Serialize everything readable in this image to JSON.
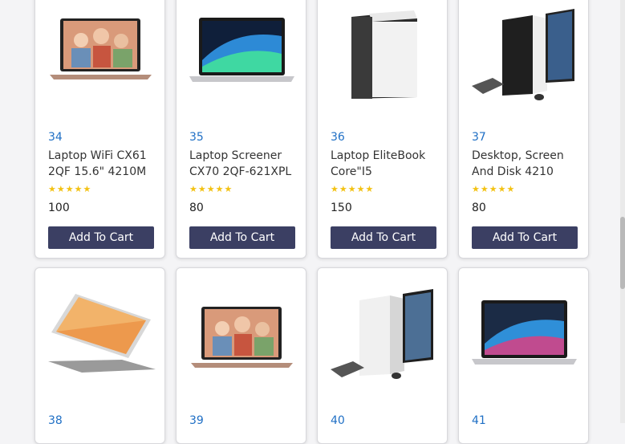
{
  "products": [
    {
      "id": "34",
      "name": "Laptop WiFi CX61\n2QF 15.6\" 4210M",
      "stars": "★★★★★",
      "price": "100",
      "cart_label": "Add To Cart",
      "image": "laptop-video-call"
    },
    {
      "id": "35",
      "name": "Laptop Screener\nCX70 2QF-621XPL",
      "stars": "★★★★★",
      "price": "80",
      "cart_label": "Add To Cart",
      "image": "macbook"
    },
    {
      "id": "36",
      "name": "Laptop EliteBook\nCore\"I5",
      "stars": "★★★★★",
      "price": "150",
      "cart_label": "Add To Cart",
      "image": "pc-tower"
    },
    {
      "id": "37",
      "name": "Desktop, Screen\nAnd Disk 4210",
      "stars": "★★★★★",
      "price": "80",
      "cart_label": "Add To Cart",
      "image": "desktop-set"
    },
    {
      "id": "38",
      "image": "convertible-laptop"
    },
    {
      "id": "39",
      "image": "laptop-video-call"
    },
    {
      "id": "40",
      "image": "desktop-set"
    },
    {
      "id": "41",
      "image": "macbook"
    }
  ],
  "colors": {
    "accent": "#3b3f63",
    "id_blue": "#1f6fc5",
    "star": "#f3c213"
  }
}
